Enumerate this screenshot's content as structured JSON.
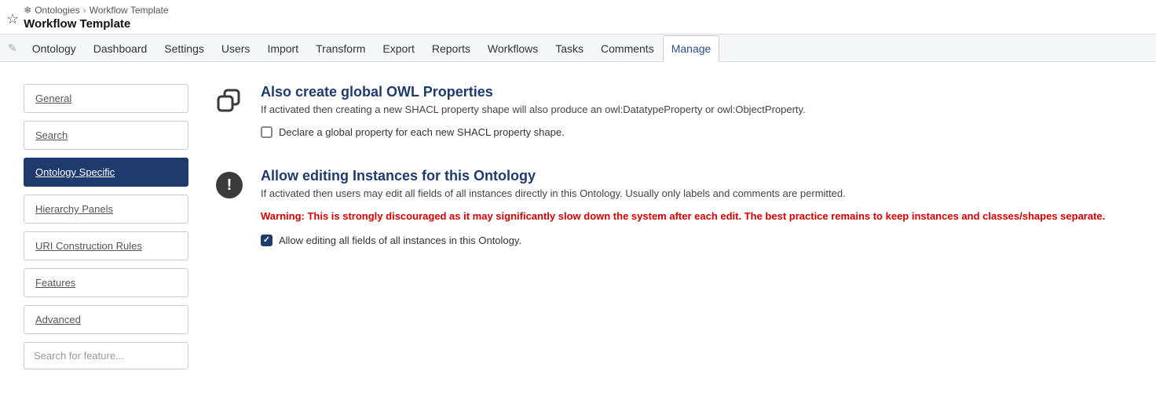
{
  "breadcrumb": {
    "root": "Ontologies",
    "current": "Workflow Template"
  },
  "page_title": "Workflow Template",
  "tabs": [
    {
      "label": "Ontology"
    },
    {
      "label": "Dashboard"
    },
    {
      "label": "Settings"
    },
    {
      "label": "Users"
    },
    {
      "label": "Import"
    },
    {
      "label": "Transform"
    },
    {
      "label": "Export"
    },
    {
      "label": "Reports"
    },
    {
      "label": "Workflows"
    },
    {
      "label": "Tasks"
    },
    {
      "label": "Comments"
    },
    {
      "label": "Manage",
      "active": true
    }
  ],
  "sidebar": {
    "items": [
      {
        "label": "General"
      },
      {
        "label": "Search"
      },
      {
        "label": "Ontology Specific",
        "active": true
      },
      {
        "label": "Hierarchy Panels"
      },
      {
        "label": "URI Construction Rules"
      },
      {
        "label": "Features"
      },
      {
        "label": "Advanced"
      }
    ],
    "search_placeholder": "Search for feature..."
  },
  "sections": {
    "owl": {
      "title": "Also create global OWL Properties",
      "desc": "If activated then creating a new SHACL property shape will also produce an owl:DatatypeProperty or owl:ObjectProperty.",
      "checkbox_label": "Declare a global property for each new SHACL property shape.",
      "checked": false
    },
    "instances": {
      "title": "Allow editing Instances for this Ontology",
      "desc": "If activated then users may edit all fields of all instances directly in this Ontology. Usually only labels and comments are permitted.",
      "warning": "Warning: This is strongly discouraged as it may significantly slow down the system after each edit. The best practice remains to keep instances and classes/shapes separate.",
      "checkbox_label": "Allow editing all fields of all instances in this Ontology.",
      "checked": true
    }
  }
}
